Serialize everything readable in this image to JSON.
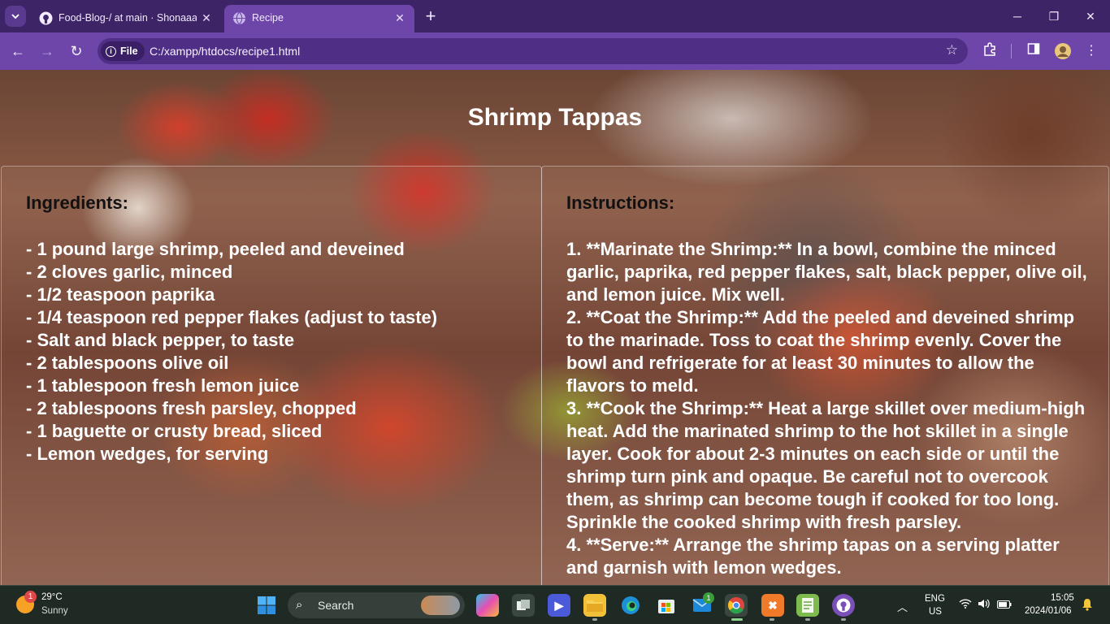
{
  "browser": {
    "tabs": [
      {
        "title": "Food-Blog-/ at main · Shonaaaz",
        "icon": "github-icon",
        "active": false
      },
      {
        "title": "Recipe",
        "icon": "globe-icon",
        "active": true
      }
    ],
    "new_tab_label": "+",
    "address": {
      "scheme_label": "File",
      "url": "C:/xampp/htdocs/recipe1.html"
    }
  },
  "page": {
    "title": "Shrimp Tappas",
    "ingredients": {
      "heading": "Ingredients:",
      "items": [
        "- 1 pound large shrimp, peeled and deveined",
        "- 2 cloves garlic, minced",
        "- 1/2 teaspoon paprika",
        "- 1/4 teaspoon red pepper flakes (adjust to taste)",
        "- Salt and black pepper, to taste",
        "- 2 tablespoons olive oil",
        "- 1 tablespoon fresh lemon juice",
        "- 2 tablespoons fresh parsley, chopped",
        "- 1 baguette or crusty bread, sliced",
        "- Lemon wedges, for serving"
      ]
    },
    "instructions": {
      "heading": "Instructions:",
      "steps": [
        "1. **Marinate the Shrimp:** In a bowl, combine the minced garlic, paprika, red pepper flakes, salt, black pepper, olive oil, and lemon juice. Mix well.",
        "2. **Coat the Shrimp:** Add the peeled and deveined shrimp to the marinade. Toss to coat the shrimp evenly. Cover the bowl and refrigerate for at least 30 minutes to allow the flavors to meld.",
        "3. **Cook the Shrimp:** Heat a large skillet over medium-high heat. Add the marinated shrimp to the hot skillet in a single layer. Cook for about 2-3 minutes on each side or until the shrimp turn pink and opaque. Be careful not to overcook them, as shrimp can become tough if cooked for too long. Sprinkle the cooked shrimp with fresh parsley.",
        "4. **Serve:** Arrange the shrimp tapas on a serving platter and garnish with lemon wedges."
      ]
    }
  },
  "taskbar": {
    "weather": {
      "temp": "29°C",
      "condition": "Sunny",
      "badge": "1"
    },
    "search_label": "Search",
    "mail_badge": "1",
    "language": {
      "line1": "ENG",
      "line2": "US"
    },
    "clock": {
      "time": "15:05",
      "date": "2024/01/06"
    }
  },
  "colors": {
    "titlebar": "#3d2466",
    "toolbar": "#6e46a9",
    "omnibox": "#4f2e86",
    "taskbar": "#1f2a24"
  }
}
